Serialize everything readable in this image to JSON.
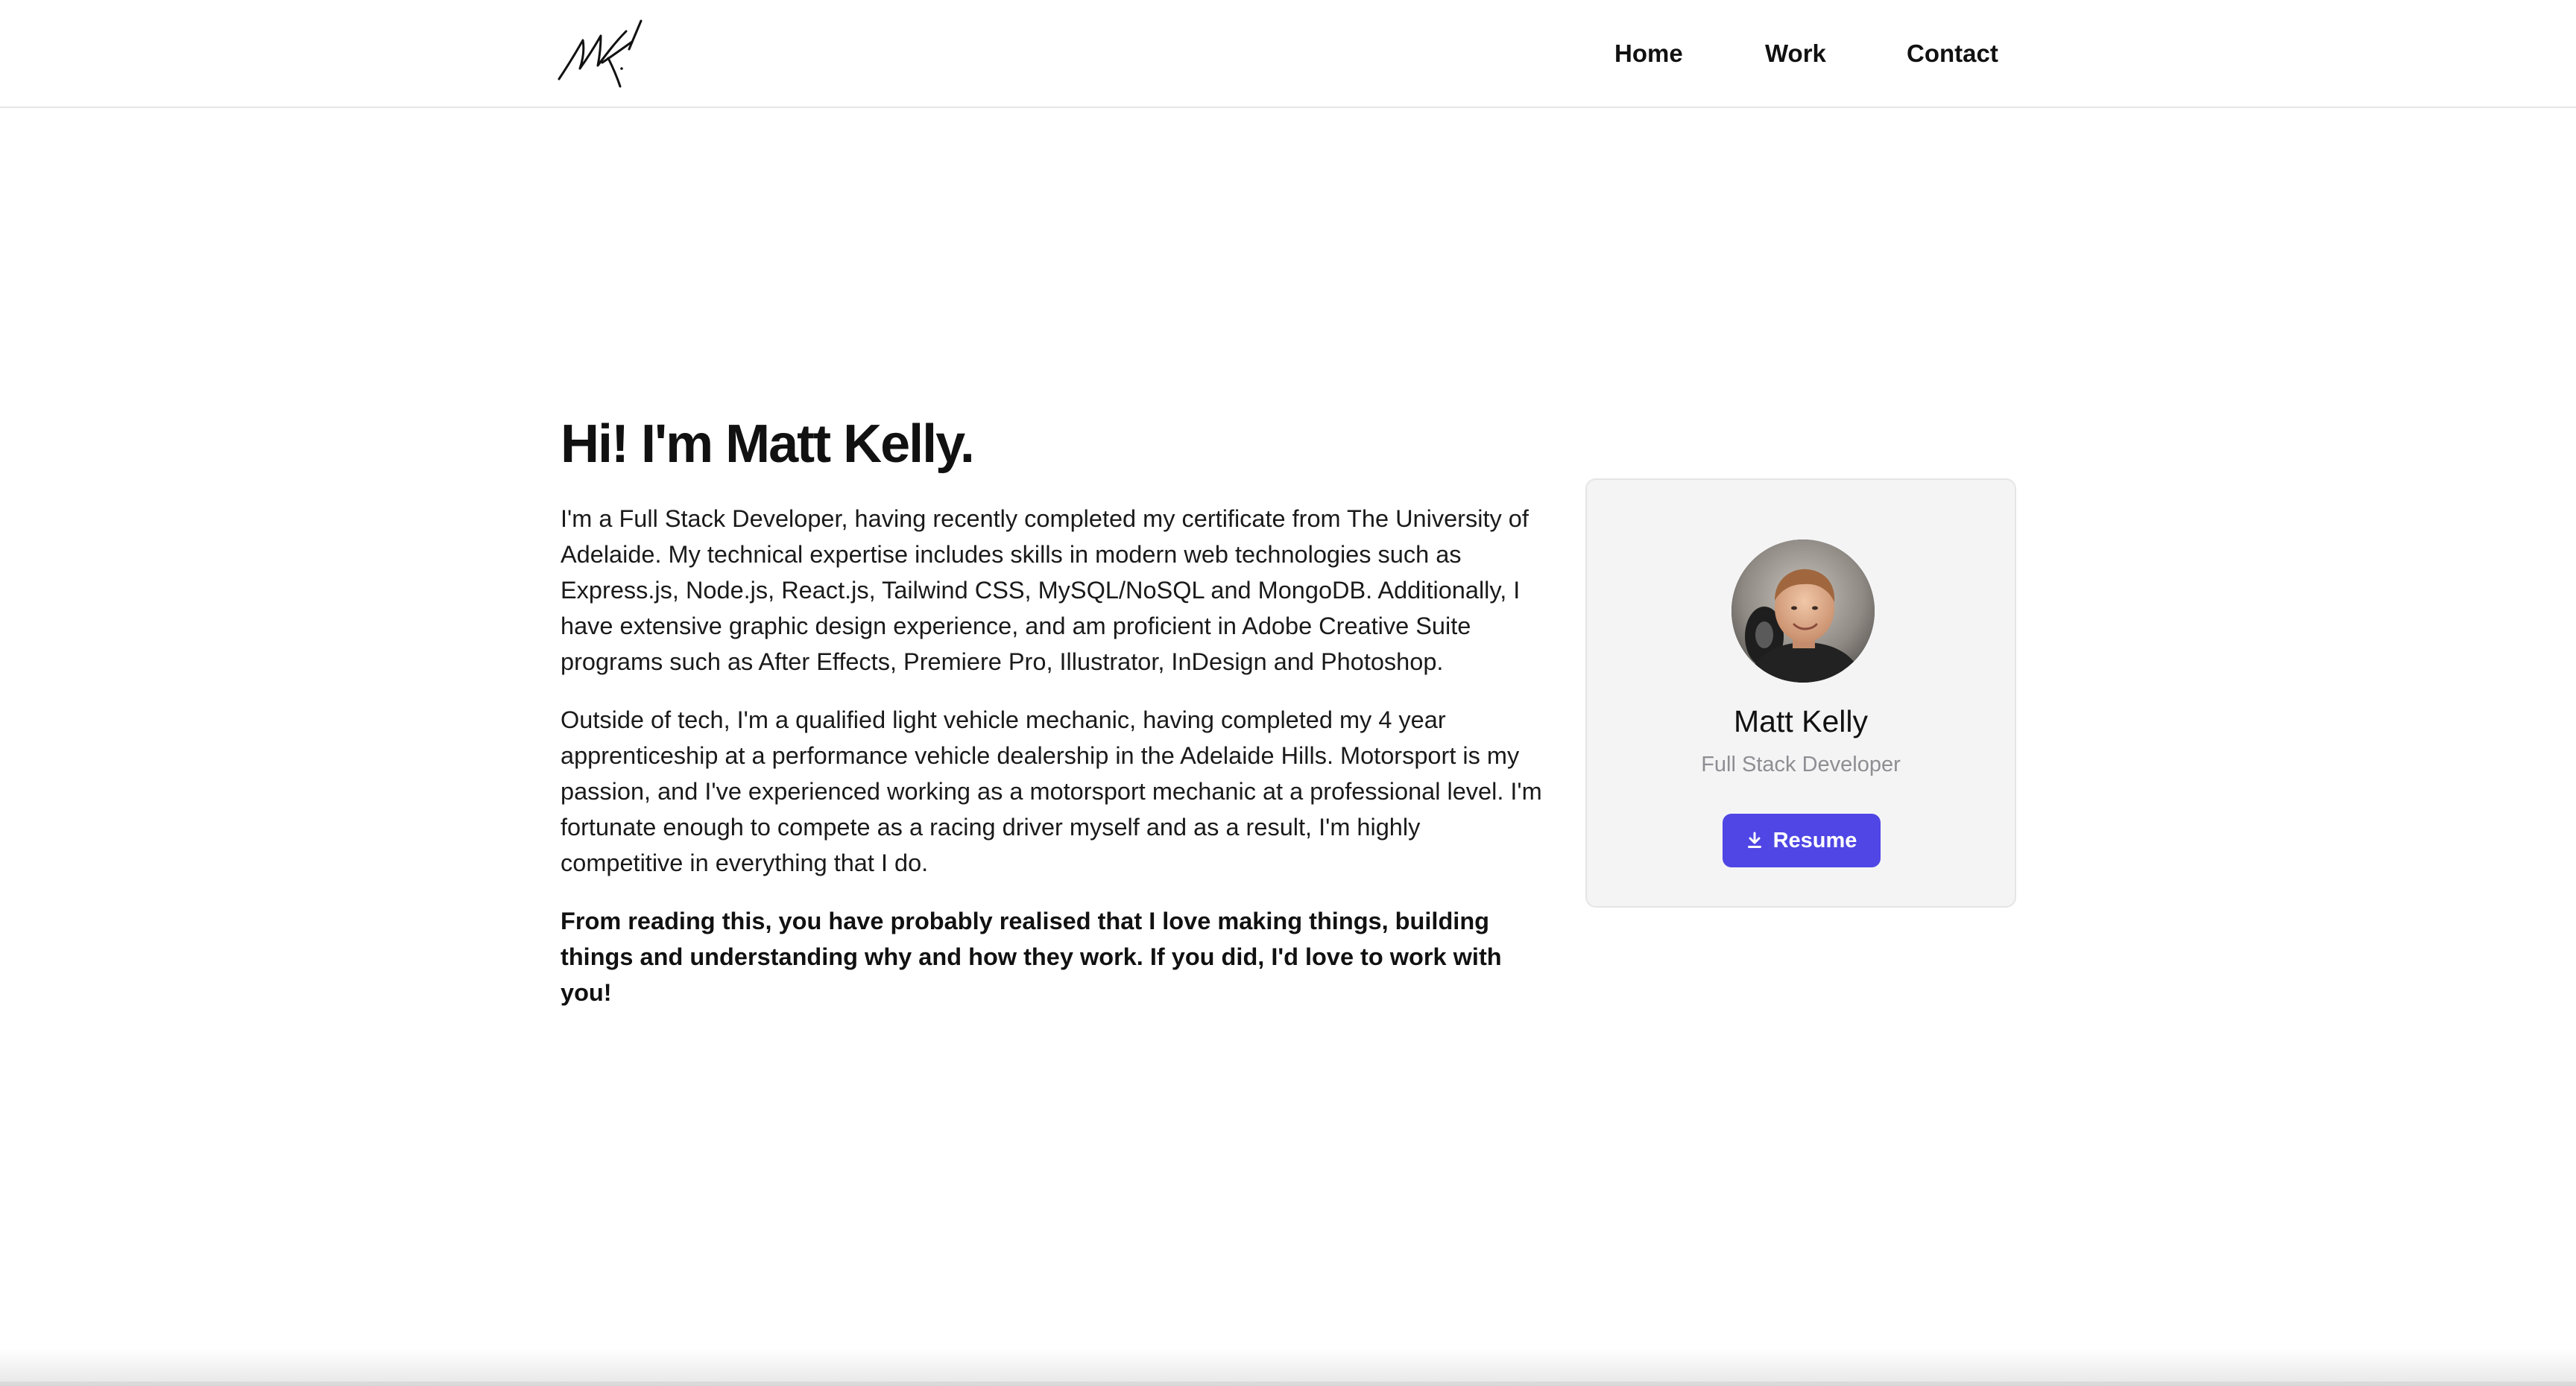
{
  "header": {
    "logo_icon": "signature-logo",
    "nav": {
      "home": "Home",
      "work": "Work",
      "contact": "Contact"
    }
  },
  "intro": {
    "heading": "Hi! I'm Matt Kelly.",
    "paragraph_1": "I'm a Full Stack Developer, having recently completed my certificate from The University of Adelaide. My technical expertise includes skills in modern web technologies such as Express.js, Node.js, React.js, Tailwind CSS, MySQL/NoSQL and MongoDB. Additionally, I have extensive graphic design experience, and am proficient in Adobe Creative Suite programs such as After Effects, Premiere Pro, Illustrator, InDesign and Photoshop.",
    "paragraph_2": "Outside of tech, I'm a qualified light vehicle mechanic, having completed my 4 year apprenticeship at a performance vehicle dealership in the Adelaide Hills. Motorsport is my passion, and I've experienced working as a motorsport mechanic at a professional level. I'm fortunate enough to compete as a racing driver myself and as a result, I'm highly competitive in everything that I do.",
    "paragraph_3": "From reading this, you have probably realised that I love making things, building things and understanding why and how they work. If you did, I'd love to work with you!"
  },
  "profile_card": {
    "name": "Matt Kelly",
    "role": "Full Stack Developer",
    "resume_label": "Resume",
    "resume_icon": "download-icon"
  },
  "colors": {
    "accent": "#4f46e5",
    "card_bg": "#f4f4f5",
    "muted_text": "#8e8e93"
  }
}
